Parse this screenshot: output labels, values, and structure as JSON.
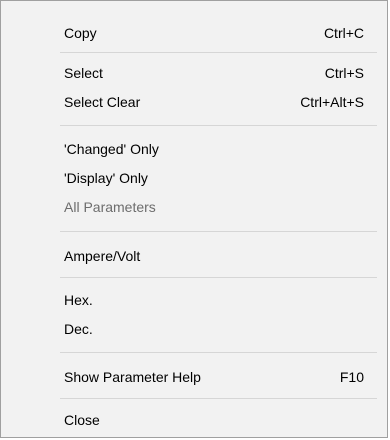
{
  "menu": {
    "items": [
      {
        "label": "Copy",
        "shortcut": "Ctrl+C",
        "enabled": true
      },
      {
        "label": "Select",
        "shortcut": "Ctrl+S",
        "enabled": true
      },
      {
        "label": "Select Clear",
        "shortcut": "Ctrl+Alt+S",
        "enabled": true
      },
      {
        "label": "'Changed' Only",
        "shortcut": "",
        "enabled": true
      },
      {
        "label": "'Display' Only",
        "shortcut": "",
        "enabled": true
      },
      {
        "label": "All Parameters",
        "shortcut": "",
        "enabled": false
      },
      {
        "label": "Ampere/Volt",
        "shortcut": "",
        "enabled": true
      },
      {
        "label": "Hex.",
        "shortcut": "",
        "enabled": true
      },
      {
        "label": "Dec.",
        "shortcut": "",
        "enabled": true
      },
      {
        "label": "Show Parameter Help",
        "shortcut": "F10",
        "enabled": true
      },
      {
        "label": "Close",
        "shortcut": "",
        "enabled": true
      }
    ]
  }
}
